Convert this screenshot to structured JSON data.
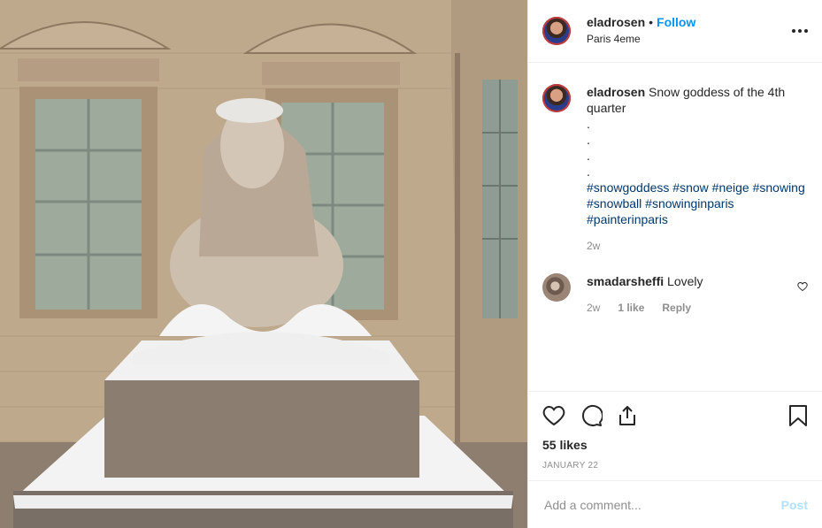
{
  "post": {
    "image_alt": "Snow-covered stone sphinx statue in a Paris courtyard",
    "author": {
      "username": "eladrosen",
      "dot": "•",
      "follow_label": "Follow",
      "location": "Paris 4eme"
    },
    "more_icon": "more-horizontal-icon",
    "caption": {
      "username": "eladrosen",
      "text": "Snow goddess of the 4th quarter",
      "dots": [
        ".",
        ".",
        ".",
        "."
      ],
      "hashtags": [
        "#snowgoddess",
        "#snow",
        "#neige",
        "#snowing",
        "#snowball",
        "#snowinginparis",
        "#painterinparis"
      ],
      "time": "2w"
    },
    "comments": [
      {
        "username": "smadarsheffi",
        "text": "Lovely",
        "time": "2w",
        "likes_label": "1 like",
        "reply_label": "Reply"
      }
    ],
    "likes": "55 likes",
    "date": "JANUARY 22",
    "add_comment": {
      "placeholder": "Add a comment...",
      "post_label": "Post"
    }
  },
  "colors": {
    "link": "#0095f6",
    "hashtag": "#00376b",
    "muted": "#8e8e8e",
    "post_disabled": "#b2dffc"
  }
}
